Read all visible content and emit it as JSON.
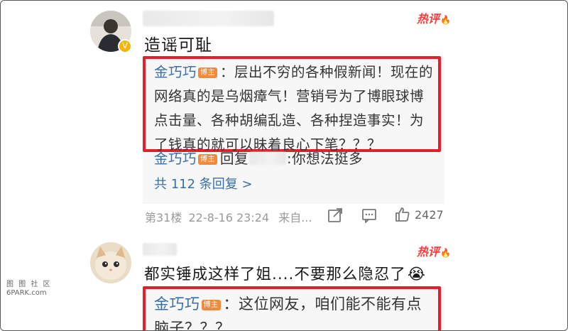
{
  "comment1": {
    "text": "造谣可耻",
    "hot_label": "热评",
    "reply1_name": "金巧巧",
    "reply1_badge": "博主",
    "reply1_text": "：层出不穷的各种假新闻！现在的网络真的是乌烟瘴气！营销号为了博眼球博点击量、各种胡编乱造、各种捏造事实！为了钱真的就可以昧着良心下笔？？？",
    "reply2_name": "金巧巧",
    "reply2_badge": "博主",
    "reply2_prefix": "回复",
    "reply2_text": ":你想法挺多",
    "more_replies": "共 112 条回复 >",
    "floor": "第31楼",
    "timestamp": "22-8-16 23:24",
    "source": "来自...",
    "like_count": "2427"
  },
  "comment2": {
    "text": "都实锤成这样了姐....不要那么隐忍了",
    "emoji": "😭",
    "hot_label": "热评",
    "reply1_name": "金巧巧",
    "reply1_badge": "博主",
    "reply1_text": "：这位网友，咱们能不能有点脑子？？？"
  },
  "watermark": {
    "line1": "图 图 社 区",
    "line2": "6PARK.com"
  },
  "colors": {
    "red_frame": "#e0202a",
    "hot": "#ff3a3a",
    "blogger_name": "#3a6ea8",
    "badge": "#f3893b"
  }
}
